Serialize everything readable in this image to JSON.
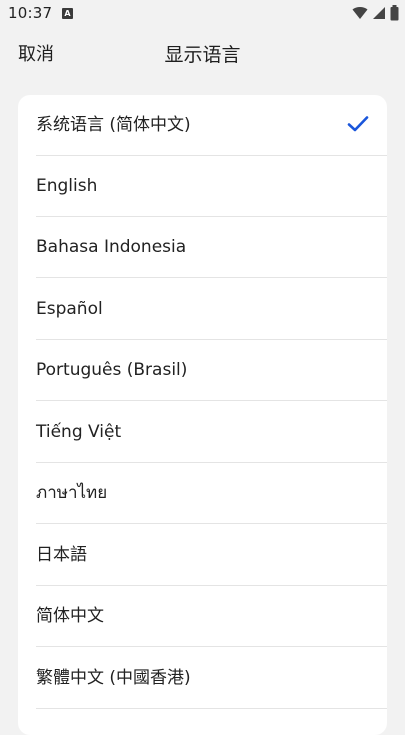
{
  "status_bar": {
    "time": "10:37",
    "notification_icon": "a-letter-icon",
    "icons": [
      "wifi-icon",
      "cell-signal-icon",
      "battery-icon"
    ]
  },
  "header": {
    "cancel_label": "取消",
    "title": "显示语言"
  },
  "languages": [
    {
      "label": "系统语言 (简体中文)",
      "selected": true
    },
    {
      "label": "English",
      "selected": false
    },
    {
      "label": "Bahasa Indonesia",
      "selected": false
    },
    {
      "label": "Español",
      "selected": false
    },
    {
      "label": "Português (Brasil)",
      "selected": false
    },
    {
      "label": "Tiếng Việt",
      "selected": false
    },
    {
      "label": "ภาษาไทย",
      "selected": false
    },
    {
      "label": "日本語",
      "selected": false
    },
    {
      "label": "简体中文",
      "selected": false
    },
    {
      "label": "繁體中文 (中國香港)",
      "selected": false
    }
  ],
  "colors": {
    "accent": "#1a56db",
    "background": "#f2f2f2",
    "card": "#ffffff"
  }
}
